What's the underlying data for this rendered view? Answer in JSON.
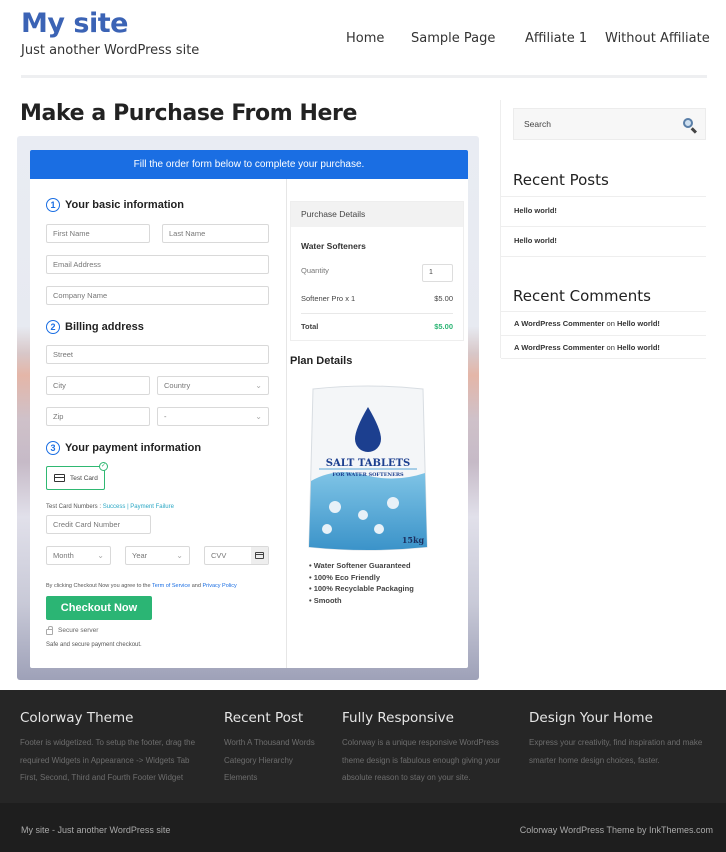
{
  "header": {
    "site_title": "My site",
    "tagline": "Just another WordPress site",
    "nav": [
      "Home",
      "Sample Page",
      "Affiliate 1",
      "Without Affiliate"
    ]
  },
  "page_title": "Make a Purchase From Here",
  "form": {
    "banner": "Fill the order form below to complete your purchase.",
    "step1": {
      "num": "1",
      "label": "Your basic information"
    },
    "step2": {
      "num": "2",
      "label": "Billing address"
    },
    "step3": {
      "num": "3",
      "label": "Your payment information"
    },
    "placeholders": {
      "first_name": "First Name",
      "last_name": "Last Name",
      "email": "Email Address",
      "company": "Company Name",
      "street": "Street",
      "city": "City",
      "country": "Country",
      "zip": "Zip",
      "state": "-",
      "card_number": "Credit Card Number",
      "month": "Month",
      "year": "Year",
      "cvv": "CVV"
    },
    "test_card_label": "Test Card",
    "test_card_numbers_label": "Test Card Numbers :",
    "success_link": "Success",
    "separator": "|",
    "failure_link": "Payment Failure",
    "agree_prefix": "By clicking Checkout Now you agree to the",
    "terms_link": "Term of Service",
    "and": "and",
    "privacy_link": "Privacy Policy",
    "checkout_button": "Checkout Now",
    "secure_server": "Secure server",
    "safe_text": "Safe and secure payment checkout."
  },
  "purchase": {
    "header": "Purchase Details",
    "product_group": "Water Softeners",
    "quantity_label": "Quantity",
    "quantity_value": "1",
    "line_item": "Softener Pro x 1",
    "line_price": "$5.00",
    "total_label": "Total",
    "total_value": "$5.00",
    "total_color": "#2bb574"
  },
  "plan": {
    "title": "Plan Details",
    "product_text1": "SALT TABLETS",
    "product_text2": "FOR WATER SOFTENERS",
    "product_weight": "15kg",
    "features": [
      "Water Softener Guaranteed",
      "100% Eco Friendly",
      "100% Recyclable Packaging",
      "Smooth"
    ]
  },
  "sidebar": {
    "search_placeholder": "Search",
    "recent_posts_title": "Recent Posts",
    "recent_posts": [
      "Hello world!",
      "Hello world!"
    ],
    "recent_comments_title": "Recent Comments",
    "recent_comments": [
      {
        "author": "A WordPress Commenter",
        "on": "on",
        "post": "Hello world!"
      },
      {
        "author": "A WordPress Commenter",
        "on": "on",
        "post": "Hello world!"
      }
    ]
  },
  "footer": {
    "columns": [
      {
        "title": "Colorway Theme",
        "lines": [
          "Footer is widgetized. To setup the footer, drag the",
          "required Widgets in Appearance -> Widgets Tab",
          "First, Second, Third and Fourth Footer Widget"
        ]
      },
      {
        "title": "Recent Post",
        "lines": [
          "Worth A Thousand Words",
          "Category Hierarchy",
          "Elements"
        ]
      },
      {
        "title": "Fully Responsive",
        "lines": [
          "Colorway is a unique responsive WordPress",
          "theme design is fabulous enough giving your",
          "absolute reason to stay on your site."
        ]
      },
      {
        "title": "Design Your Home",
        "lines": [
          "Express your creativity, find inspiration and make",
          "smarter home design choices, faster."
        ]
      }
    ],
    "bottom_left": "My site - Just another WordPress site",
    "bottom_right": "Colorway WordPress Theme by InkThemes.com"
  },
  "colors": {
    "brand_blue": "#3b63b5",
    "banner_blue": "#1a6ee3",
    "checkout_green": "#2bb574",
    "footer_bg": "#262626"
  }
}
